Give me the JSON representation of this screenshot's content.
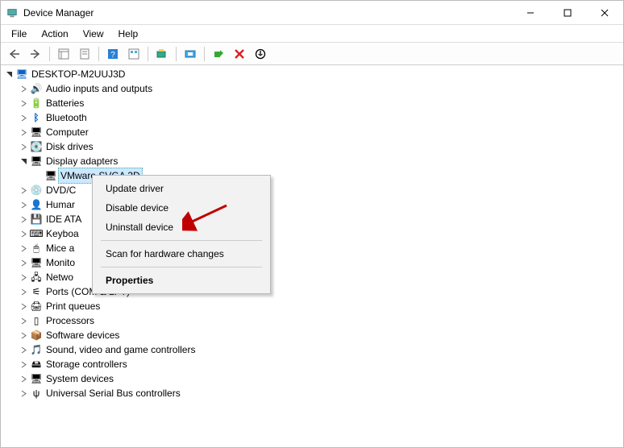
{
  "titlebar": {
    "title": "Device Manager"
  },
  "menubar": {
    "items": [
      "File",
      "Action",
      "View",
      "Help"
    ]
  },
  "tree": {
    "root": "DESKTOP-M2UUJ3D",
    "nodes": [
      {
        "label": "Audio inputs and outputs",
        "icon": "audio",
        "exp": "closed"
      },
      {
        "label": "Batteries",
        "icon": "battery",
        "exp": "closed"
      },
      {
        "label": "Bluetooth",
        "icon": "bluetooth",
        "exp": "closed"
      },
      {
        "label": "Computer",
        "icon": "computer",
        "exp": "closed"
      },
      {
        "label": "Disk drives",
        "icon": "disk",
        "exp": "closed"
      },
      {
        "label": "Display adapters",
        "icon": "display",
        "exp": "open",
        "children": [
          {
            "label": "VMware SVGA 3D",
            "icon": "display",
            "selected": true
          }
        ]
      },
      {
        "label": "DVD/C",
        "icon": "dvd",
        "exp": "closed"
      },
      {
        "label": "Humar",
        "icon": "hid",
        "exp": "closed"
      },
      {
        "label": "IDE ATA",
        "icon": "ide",
        "exp": "closed"
      },
      {
        "label": "Keyboa",
        "icon": "keyboard",
        "exp": "closed"
      },
      {
        "label": "Mice a",
        "icon": "mouse",
        "exp": "closed"
      },
      {
        "label": "Monito",
        "icon": "monitor",
        "exp": "closed"
      },
      {
        "label": "Netwo",
        "icon": "network",
        "exp": "closed"
      },
      {
        "label": "Ports (COM & LPT)",
        "icon": "port",
        "exp": "closed"
      },
      {
        "label": "Print queues",
        "icon": "printer",
        "exp": "closed"
      },
      {
        "label": "Processors",
        "icon": "cpu",
        "exp": "closed"
      },
      {
        "label": "Software devices",
        "icon": "software",
        "exp": "closed"
      },
      {
        "label": "Sound, video and game controllers",
        "icon": "sound",
        "exp": "closed"
      },
      {
        "label": "Storage controllers",
        "icon": "storage",
        "exp": "closed"
      },
      {
        "label": "System devices",
        "icon": "system",
        "exp": "closed"
      },
      {
        "label": "Universal Serial Bus controllers",
        "icon": "usb",
        "exp": "closed"
      }
    ]
  },
  "context_menu": {
    "items": [
      {
        "label": "Update driver",
        "type": "item"
      },
      {
        "label": "Disable device",
        "type": "item"
      },
      {
        "label": "Uninstall device",
        "type": "item"
      },
      {
        "type": "sep"
      },
      {
        "label": "Scan for hardware changes",
        "type": "item"
      },
      {
        "type": "sep"
      },
      {
        "label": "Properties",
        "type": "bold"
      }
    ]
  },
  "icon_glyphs": {
    "computer-root": "🖥",
    "audio": "🔊",
    "battery": "🔋",
    "bluetooth": "ᛒ",
    "computer": "🖥",
    "disk": "💽",
    "display": "🖥",
    "dvd": "💿",
    "hid": "👤",
    "ide": "💾",
    "keyboard": "⌨",
    "mouse": "🖱",
    "monitor": "🖥",
    "network": "🖧",
    "port": "⚟",
    "printer": "🖨",
    "cpu": "▯",
    "software": "📦",
    "sound": "🎵",
    "storage": "🖴",
    "system": "🖥",
    "usb": "ψ"
  },
  "colors": {
    "selection": "#cce8ff",
    "arrow": "#c00000"
  }
}
